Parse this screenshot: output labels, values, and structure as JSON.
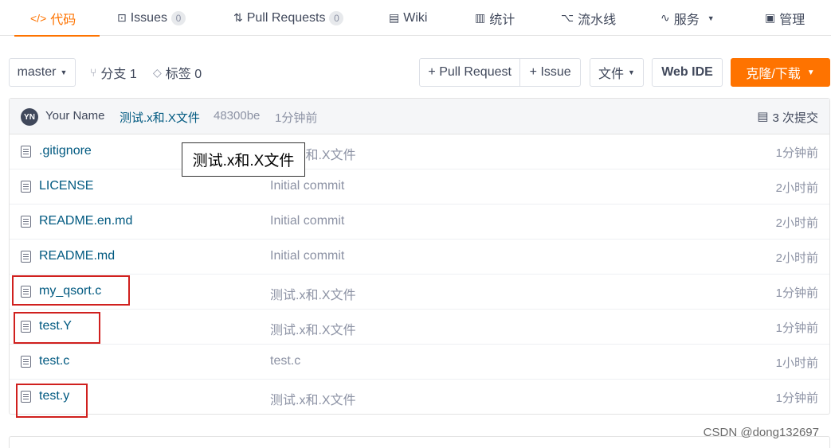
{
  "nav": {
    "tabs": [
      {
        "label": "代码",
        "icon": "code-icon",
        "glyph": "</>",
        "active": true
      },
      {
        "label": "Issues",
        "icon": "issues-icon",
        "glyph": "⊡",
        "count": "0"
      },
      {
        "label": "Pull Requests",
        "icon": "pull-request-icon",
        "glyph": "⇅",
        "count": "0"
      },
      {
        "label": "Wiki",
        "icon": "wiki-icon",
        "glyph": "▤"
      },
      {
        "label": "统计",
        "icon": "stats-icon",
        "glyph": "▥"
      },
      {
        "label": "流水线",
        "icon": "pipeline-icon",
        "glyph": "⌥"
      },
      {
        "label": "服务",
        "icon": "service-icon",
        "glyph": "∿"
      },
      {
        "label": "管理",
        "icon": "manage-icon",
        "glyph": "▣"
      }
    ]
  },
  "toolbar": {
    "branch": "master",
    "branches_label": "分支 1",
    "tags_label": "标签 0",
    "pull_request_btn": "+ Pull Request",
    "issue_btn": "+ Issue",
    "file_btn": "文件",
    "webide_btn": "Web IDE",
    "clone_btn": "克隆/下载"
  },
  "commit": {
    "avatar_initials": "YN",
    "author": "Your Name",
    "message": "测试.x和.X文件",
    "hash": "48300be",
    "time": "1分钟前",
    "count_label": "3 次提交"
  },
  "files": [
    {
      "name": ".gitignore",
      "message": "测试.x和.X文件",
      "time": "1分钟前"
    },
    {
      "name": "LICENSE",
      "message": "Initial commit",
      "time": "2小时前"
    },
    {
      "name": "README.en.md",
      "message": "Initial commit",
      "time": "2小时前"
    },
    {
      "name": "README.md",
      "message": "Initial commit",
      "time": "2小时前"
    },
    {
      "name": "my_qsort.c",
      "message": "测试.x和.X文件",
      "time": "1分钟前",
      "highlighted": true
    },
    {
      "name": "test.Y",
      "message": "测试.x和.X文件",
      "time": "1分钟前",
      "highlighted": true
    },
    {
      "name": "test.c",
      "message": "test.c",
      "time": "1小时前"
    },
    {
      "name": "test.y",
      "message": "测试.x和.X文件",
      "time": "1分钟前",
      "highlighted": true
    }
  ],
  "tooltip": "测试.x和.X文件",
  "watermark": "CSDN @dong132697",
  "colors": {
    "accent": "#fe7300",
    "link": "#005980",
    "highlight": "#d0201e"
  }
}
